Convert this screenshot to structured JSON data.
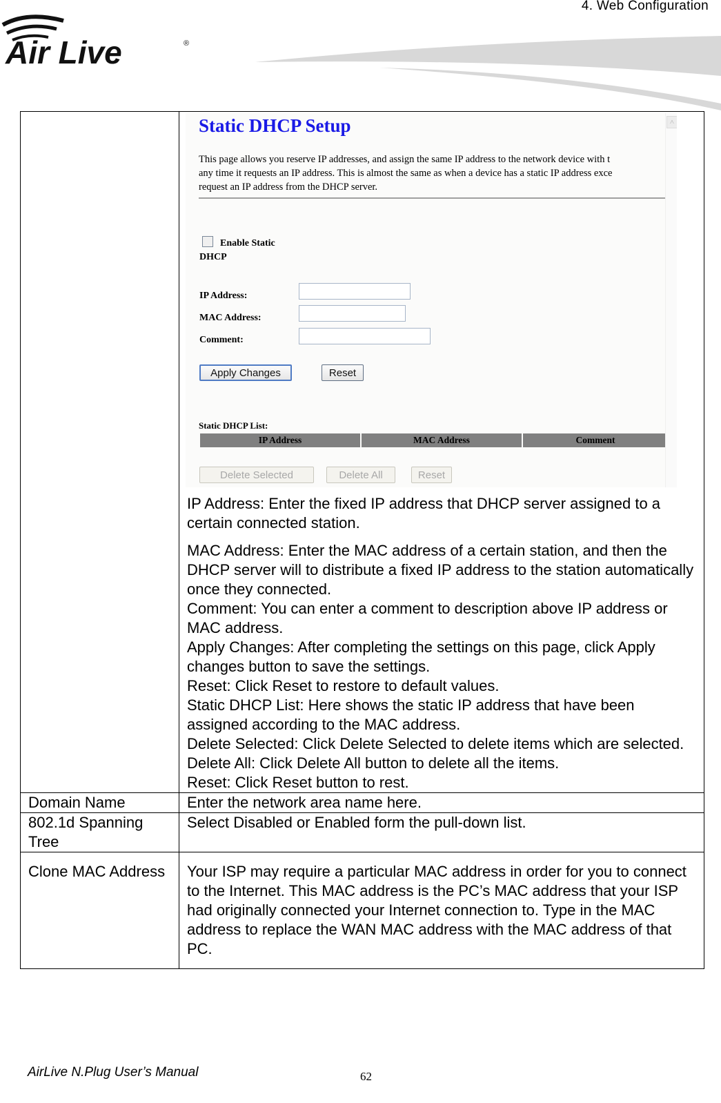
{
  "header": {
    "chapter": "4.  Web  Configuration",
    "logo_text": "Air Live",
    "logo_icon": "wireless-signal-icon"
  },
  "table": {
    "rows": [
      {
        "label": "",
        "screenshot": {
          "title": "Static DHCP Setup",
          "intro_lines": [
            "This page allows you reserve IP addresses, and assign the same IP address to the network device with t",
            "any time it requests an IP address. This is almost the same as when a device has a static IP address exce",
            "request an IP address from the DHCP server."
          ],
          "enable_label_line1": "Enable Static",
          "enable_label_line2": "DHCP",
          "enable_checked": false,
          "fields": [
            {
              "label": "IP Address:",
              "value": ""
            },
            {
              "label": "MAC Address:",
              "value": ""
            },
            {
              "label": "Comment:",
              "value": ""
            }
          ],
          "apply_button": "Apply Changes",
          "reset_button": "Reset",
          "list_title": "Static DHCP List:",
          "list_columns": [
            "IP Address",
            "MAC Address",
            "Comment"
          ],
          "list_rows": [],
          "delete_selected_button": "Delete Selected",
          "delete_all_button": "Delete All",
          "list_reset_button": "Reset"
        },
        "paragraphs": [
          "IP Address: Enter the fixed IP address that DHCP server assigned to a certain connected station.",
          "MAC Address: Enter the MAC address of a certain station, and then the DHCP server will to distribute a fixed IP address to the station automatically once they connected.",
          "Comment: You can enter a comment to description above IP address or MAC address.",
          "Apply Changes: After completing the settings on this page, click Apply changes button to save the settings.",
          "Reset: Click Reset to restore to default values.",
          "Static DHCP List: Here shows the static IP address that have been assigned according to the MAC address.",
          "Delete Selected: Click Delete Selected to delete items which are selected.",
          "Delete All: Click Delete All button to delete all the items.",
          "Reset: Click Reset button to rest."
        ]
      },
      {
        "label": "Domain Name",
        "text": "Enter the network area name here."
      },
      {
        "label": "802.1d Spanning Tree",
        "text": "Select Disabled or Enabled form the pull-down list."
      },
      {
        "label": "Clone MAC Address",
        "text": "Your ISP may require a particular MAC address in order for you to connect to the Internet. This MAC address is the PC’s MAC address that your ISP had originally connected your Internet connection to. Type in the MAC address to replace the WAN MAC address with the MAC address of that PC."
      }
    ]
  },
  "footer": {
    "manual": "AirLive N.Plug User’s Manual",
    "page": "62"
  }
}
